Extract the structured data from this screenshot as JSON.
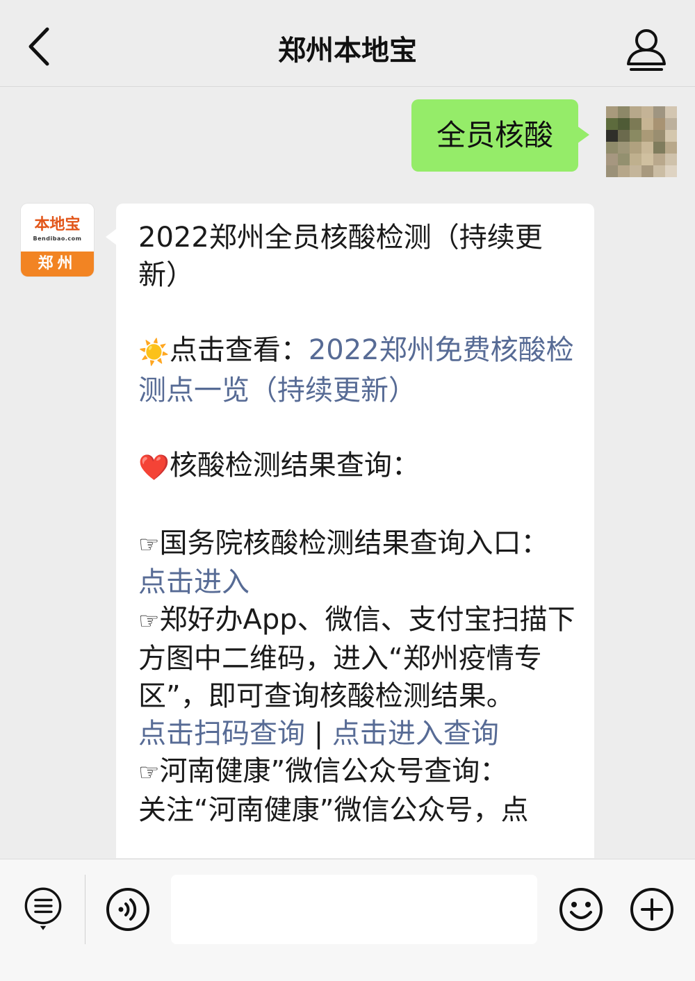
{
  "nav": {
    "title": "郑州本地宝",
    "back_icon": "chevron-left-icon",
    "profile_icon": "person-icon"
  },
  "chat": {
    "sent_message": "全员核酸",
    "bot_avatar": {
      "brand": "本地宝",
      "url": "Bendibao.com",
      "city": "郑州"
    },
    "reply": {
      "title": "2022郑州全员核酸检测（持续更新）",
      "sun_emoji": "☀️",
      "view_prefix": "点击查看：",
      "view_link": "2022郑州免费核酸检测点一览（持续更新）",
      "heart_emoji": "❤️",
      "result_heading": "核酸检测结果查询：",
      "hand_glyph": "☞",
      "guowuyuan_text": "国务院核酸检测结果查询入口：",
      "guowuyuan_link": "点击进入",
      "zhenghaoban_text": "郑好办App、微信、支付宝扫描下方图中二维码，进入“郑州疫情专区”，即可查询核酸检测结果。",
      "scan_link": "点击扫码查询",
      "separator": " | ",
      "enter_link": "点击进入查询",
      "henan_text": "河南健康”微信公众号查询：",
      "henan_follow": "关注“河南健康”微信公众号，点"
    }
  },
  "input_bar": {
    "menu_icon": "menu-list-icon",
    "voice_icon": "voice-icon",
    "input_value": "",
    "emoji_icon": "emoji-icon",
    "plus_icon": "plus-icon"
  },
  "colors": {
    "background": "#ededed",
    "sent_bubble": "#95ec69",
    "link": "#576b95",
    "bot_orange": "#f28423"
  }
}
